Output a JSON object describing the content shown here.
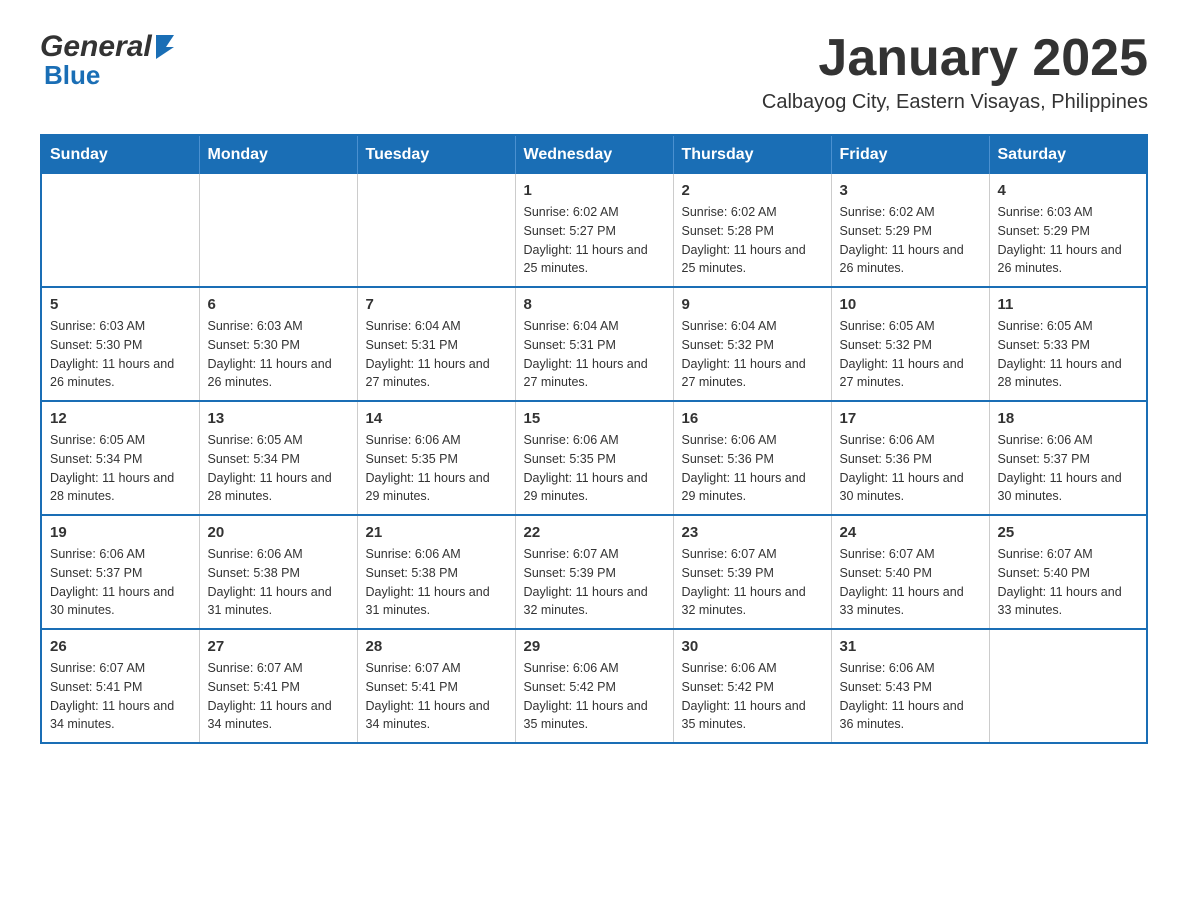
{
  "logo": {
    "general": "General",
    "blue": "Blue"
  },
  "header": {
    "month_year": "January 2025",
    "location": "Calbayog City, Eastern Visayas, Philippines"
  },
  "days_of_week": [
    "Sunday",
    "Monday",
    "Tuesday",
    "Wednesday",
    "Thursday",
    "Friday",
    "Saturday"
  ],
  "weeks": [
    [
      {
        "day": "",
        "info": ""
      },
      {
        "day": "",
        "info": ""
      },
      {
        "day": "",
        "info": ""
      },
      {
        "day": "1",
        "info": "Sunrise: 6:02 AM\nSunset: 5:27 PM\nDaylight: 11 hours and 25 minutes."
      },
      {
        "day": "2",
        "info": "Sunrise: 6:02 AM\nSunset: 5:28 PM\nDaylight: 11 hours and 25 minutes."
      },
      {
        "day": "3",
        "info": "Sunrise: 6:02 AM\nSunset: 5:29 PM\nDaylight: 11 hours and 26 minutes."
      },
      {
        "day": "4",
        "info": "Sunrise: 6:03 AM\nSunset: 5:29 PM\nDaylight: 11 hours and 26 minutes."
      }
    ],
    [
      {
        "day": "5",
        "info": "Sunrise: 6:03 AM\nSunset: 5:30 PM\nDaylight: 11 hours and 26 minutes."
      },
      {
        "day": "6",
        "info": "Sunrise: 6:03 AM\nSunset: 5:30 PM\nDaylight: 11 hours and 26 minutes."
      },
      {
        "day": "7",
        "info": "Sunrise: 6:04 AM\nSunset: 5:31 PM\nDaylight: 11 hours and 27 minutes."
      },
      {
        "day": "8",
        "info": "Sunrise: 6:04 AM\nSunset: 5:31 PM\nDaylight: 11 hours and 27 minutes."
      },
      {
        "day": "9",
        "info": "Sunrise: 6:04 AM\nSunset: 5:32 PM\nDaylight: 11 hours and 27 minutes."
      },
      {
        "day": "10",
        "info": "Sunrise: 6:05 AM\nSunset: 5:32 PM\nDaylight: 11 hours and 27 minutes."
      },
      {
        "day": "11",
        "info": "Sunrise: 6:05 AM\nSunset: 5:33 PM\nDaylight: 11 hours and 28 minutes."
      }
    ],
    [
      {
        "day": "12",
        "info": "Sunrise: 6:05 AM\nSunset: 5:34 PM\nDaylight: 11 hours and 28 minutes."
      },
      {
        "day": "13",
        "info": "Sunrise: 6:05 AM\nSunset: 5:34 PM\nDaylight: 11 hours and 28 minutes."
      },
      {
        "day": "14",
        "info": "Sunrise: 6:06 AM\nSunset: 5:35 PM\nDaylight: 11 hours and 29 minutes."
      },
      {
        "day": "15",
        "info": "Sunrise: 6:06 AM\nSunset: 5:35 PM\nDaylight: 11 hours and 29 minutes."
      },
      {
        "day": "16",
        "info": "Sunrise: 6:06 AM\nSunset: 5:36 PM\nDaylight: 11 hours and 29 minutes."
      },
      {
        "day": "17",
        "info": "Sunrise: 6:06 AM\nSunset: 5:36 PM\nDaylight: 11 hours and 30 minutes."
      },
      {
        "day": "18",
        "info": "Sunrise: 6:06 AM\nSunset: 5:37 PM\nDaylight: 11 hours and 30 minutes."
      }
    ],
    [
      {
        "day": "19",
        "info": "Sunrise: 6:06 AM\nSunset: 5:37 PM\nDaylight: 11 hours and 30 minutes."
      },
      {
        "day": "20",
        "info": "Sunrise: 6:06 AM\nSunset: 5:38 PM\nDaylight: 11 hours and 31 minutes."
      },
      {
        "day": "21",
        "info": "Sunrise: 6:06 AM\nSunset: 5:38 PM\nDaylight: 11 hours and 31 minutes."
      },
      {
        "day": "22",
        "info": "Sunrise: 6:07 AM\nSunset: 5:39 PM\nDaylight: 11 hours and 32 minutes."
      },
      {
        "day": "23",
        "info": "Sunrise: 6:07 AM\nSunset: 5:39 PM\nDaylight: 11 hours and 32 minutes."
      },
      {
        "day": "24",
        "info": "Sunrise: 6:07 AM\nSunset: 5:40 PM\nDaylight: 11 hours and 33 minutes."
      },
      {
        "day": "25",
        "info": "Sunrise: 6:07 AM\nSunset: 5:40 PM\nDaylight: 11 hours and 33 minutes."
      }
    ],
    [
      {
        "day": "26",
        "info": "Sunrise: 6:07 AM\nSunset: 5:41 PM\nDaylight: 11 hours and 34 minutes."
      },
      {
        "day": "27",
        "info": "Sunrise: 6:07 AM\nSunset: 5:41 PM\nDaylight: 11 hours and 34 minutes."
      },
      {
        "day": "28",
        "info": "Sunrise: 6:07 AM\nSunset: 5:41 PM\nDaylight: 11 hours and 34 minutes."
      },
      {
        "day": "29",
        "info": "Sunrise: 6:06 AM\nSunset: 5:42 PM\nDaylight: 11 hours and 35 minutes."
      },
      {
        "day": "30",
        "info": "Sunrise: 6:06 AM\nSunset: 5:42 PM\nDaylight: 11 hours and 35 minutes."
      },
      {
        "day": "31",
        "info": "Sunrise: 6:06 AM\nSunset: 5:43 PM\nDaylight: 11 hours and 36 minutes."
      },
      {
        "day": "",
        "info": ""
      }
    ]
  ]
}
